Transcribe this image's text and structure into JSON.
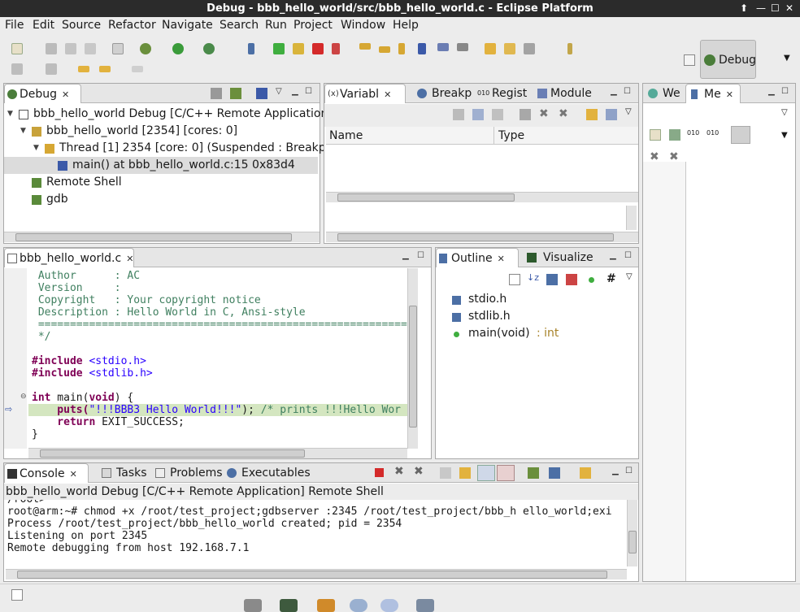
{
  "window": {
    "title": "Debug - bbb_hello_world/src/bbb_hello_world.c - Eclipse Platform",
    "controls": [
      "⬆",
      "—",
      "☐",
      "✕"
    ]
  },
  "menu": [
    "File",
    "Edit",
    "Source",
    "Refactor",
    "Navigate",
    "Search",
    "Run",
    "Project",
    "Window",
    "Help"
  ],
  "perspective": {
    "label": "Debug"
  },
  "debug_view": {
    "tab": "Debug",
    "tree": [
      {
        "label": "bbb_hello_world Debug [C/C++ Remote Application]",
        "indent": 0,
        "arrow": "▼",
        "icon": "c-app-icon"
      },
      {
        "label": "bbb_hello_world [2354] [cores: 0]",
        "indent": 1,
        "arrow": "▼",
        "icon": "process-icon"
      },
      {
        "label": "Thread [1] 2354 [core: 0] (Suspended : Breakpoin",
        "indent": 2,
        "arrow": "▼",
        "icon": "thread-icon"
      },
      {
        "label": "main() at bbb_hello_world.c:15 0x83d4",
        "indent": 3,
        "arrow": "",
        "icon": "stack-frame-icon",
        "selected": true
      },
      {
        "label": "Remote Shell",
        "indent": 1,
        "arrow": "",
        "icon": "shell-icon"
      },
      {
        "label": "gdb",
        "indent": 1,
        "arrow": "",
        "icon": "gdb-icon"
      }
    ]
  },
  "variables_view": {
    "tabs": [
      "Variabl",
      "Breakp",
      "Regist",
      "Module"
    ],
    "columns": [
      "Name",
      "Type"
    ]
  },
  "right_view": {
    "tabs": [
      "We",
      "Me"
    ]
  },
  "editor": {
    "tab": "bbb_hello_world.c",
    "lines": [
      {
        "kind": "comment",
        "text": " Author      : AC"
      },
      {
        "kind": "comment",
        "text": " Version     :"
      },
      {
        "kind": "comment",
        "text": " Copyright   : Your copyright notice"
      },
      {
        "kind": "comment",
        "text": " Description : Hello World in C, Ansi-style"
      },
      {
        "kind": "comment",
        "text": " ============================================================"
      },
      {
        "kind": "comment",
        "text": " */"
      },
      {
        "kind": "blank",
        "text": ""
      },
      {
        "kind": "include",
        "directive": "#include",
        "file": " <stdio.h>"
      },
      {
        "kind": "include",
        "directive": "#include",
        "file": " <stdlib.h>"
      },
      {
        "kind": "blank",
        "text": ""
      },
      {
        "kind": "main",
        "kw1": "int",
        "mid": " main(",
        "kw2": "void",
        "end": ") {"
      },
      {
        "kind": "current",
        "fn": "    puts(",
        "str": "\"!!!BBB3 Hello World!!!\"",
        "rest": "); ",
        "cm": "/* prints !!!Hello Wor"
      },
      {
        "kind": "return",
        "kw": "    return",
        "rest": " EXIT_SUCCESS;"
      },
      {
        "kind": "plain",
        "text": "}"
      }
    ]
  },
  "outline_view": {
    "tabs": [
      "Outline",
      "Visualize"
    ],
    "items": [
      {
        "label": "stdio.h",
        "type": "",
        "icon": "include-icon"
      },
      {
        "label": "stdlib.h",
        "type": "",
        "icon": "include-icon"
      },
      {
        "label": "main(void)",
        "type": " : int",
        "icon": "function-icon"
      }
    ]
  },
  "console_view": {
    "tabs": [
      "Console",
      "Tasks",
      "Problems",
      "Executables"
    ],
    "header": "bbb_hello_world Debug [C/C++ Remote Application] Remote Shell",
    "lines": [
      "/root>",
      "root@arm:~# chmod +x /root/test_project;gdbserver :2345 /root/test_project/bbb_h ello_world;exi",
      "Process /root/test_project/bbb_hello_world created; pid = 2354",
      "Listening on port 2345",
      "Remote debugging from host 192.168.7.1"
    ]
  },
  "colors": {
    "titlebar": "#2b2b2b",
    "current_line": "#d4e6c0",
    "keyword": "#7f0055",
    "string": "#2a00ff",
    "comment": "#3f7f5f"
  }
}
